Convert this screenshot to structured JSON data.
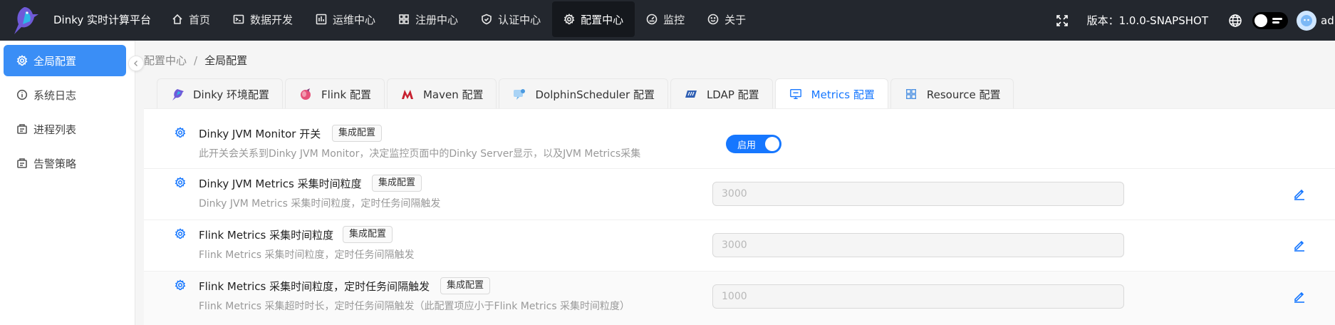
{
  "app": {
    "brand": "Dinky 实时计算平台",
    "version_text": "版本：1.0.0-SNAPSHOT",
    "username": "admin"
  },
  "nav": [
    {
      "label": "首页",
      "icon": "home-icon"
    },
    {
      "label": "数据开发",
      "icon": "terminal-icon"
    },
    {
      "label": "运维中心",
      "icon": "ops-icon"
    },
    {
      "label": "注册中心",
      "icon": "grid-icon"
    },
    {
      "label": "认证中心",
      "icon": "shield-icon"
    },
    {
      "label": "配置中心",
      "icon": "gear-icon",
      "active": true
    },
    {
      "label": "监控",
      "icon": "dashboard-icon"
    },
    {
      "label": "关于",
      "icon": "smile-icon"
    }
  ],
  "sidebar": {
    "items": [
      {
        "label": "全局配置",
        "icon": "gear-icon",
        "active": true
      },
      {
        "label": "系统日志",
        "icon": "info-icon"
      },
      {
        "label": "进程列表",
        "icon": "process-icon"
      },
      {
        "label": "告警策略",
        "icon": "alert-icon"
      }
    ]
  },
  "breadcrumb": {
    "parent": "配置中心",
    "separator": "/",
    "current": "全局配置"
  },
  "tabs": [
    {
      "label": "Dinky 环境配置"
    },
    {
      "label": "Flink 配置"
    },
    {
      "label": "Maven 配置"
    },
    {
      "label": "DolphinScheduler 配置"
    },
    {
      "label": "LDAP 配置"
    },
    {
      "label": "Metrics 配置",
      "active": true
    },
    {
      "label": "Resource 配置"
    }
  ],
  "settings": [
    {
      "title": "Dinky JVM Monitor 开关",
      "tag": "集成配置",
      "desc": "此开关会关系到Dinky JVM Monitor，决定监控页面中的Dinky Server显示，以及JVM Metrics采集",
      "switch_label": "启用",
      "enabled": true
    },
    {
      "title": "Dinky JVM Metrics 采集时间粒度",
      "tag": "集成配置",
      "desc": "Dinky JVM Metrics 采集时间粒度，定时任务间隔触发",
      "value": "3000"
    },
    {
      "title": "Flink Metrics 采集时间粒度",
      "tag": "集成配置",
      "desc": "Flink Metrics 采集时间粒度，定时任务间隔触发",
      "value": "3000"
    },
    {
      "title": "Flink Metrics 采集时间粒度，定时任务间隔触发",
      "tag": "集成配置",
      "desc": "Flink Metrics 采集超时时长，定时任务间隔触发（此配置项应小于Flink Metrics 采集时间粒度）",
      "value": "1000"
    }
  ],
  "colors": {
    "topbar": "#23272e",
    "accent": "#1677ff",
    "sidebar_active": "#3a8ef6"
  }
}
